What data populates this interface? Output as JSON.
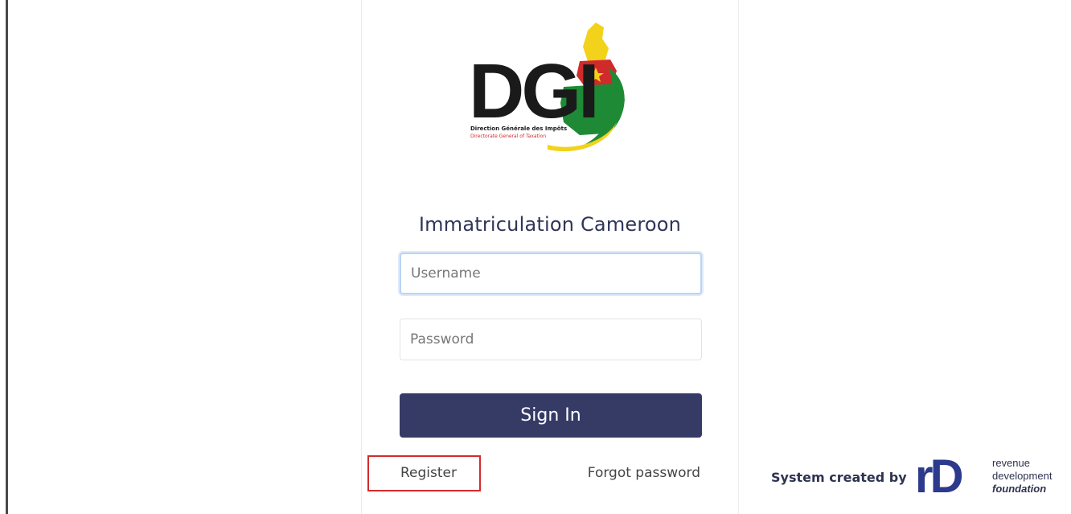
{
  "login": {
    "title": "Immatriculation Cameroon",
    "username_placeholder": "Username",
    "password_placeholder": "Password",
    "signin_label": "Sign In",
    "register_label": "Register",
    "forgot_label": "Forgot password"
  },
  "logo": {
    "letters": "DGI",
    "line1": "Direction Générale des Impôts",
    "line2": "Directorate General of Taxation",
    "colors": {
      "green": "#1e8a35",
      "red": "#d12a2a",
      "yellow": "#f2d21b",
      "dark": "#1a1a1a"
    }
  },
  "footer": {
    "credit": "System created by",
    "brand_mark": "rD",
    "brand_line1": "revenue",
    "brand_line2": "development",
    "brand_line3": "foundation",
    "brand_color": "#2b3a8c"
  },
  "colors": {
    "button": "#363b66",
    "title": "#2f3557",
    "highlight": "#d42b2b",
    "focus": "#b9d4f4"
  }
}
